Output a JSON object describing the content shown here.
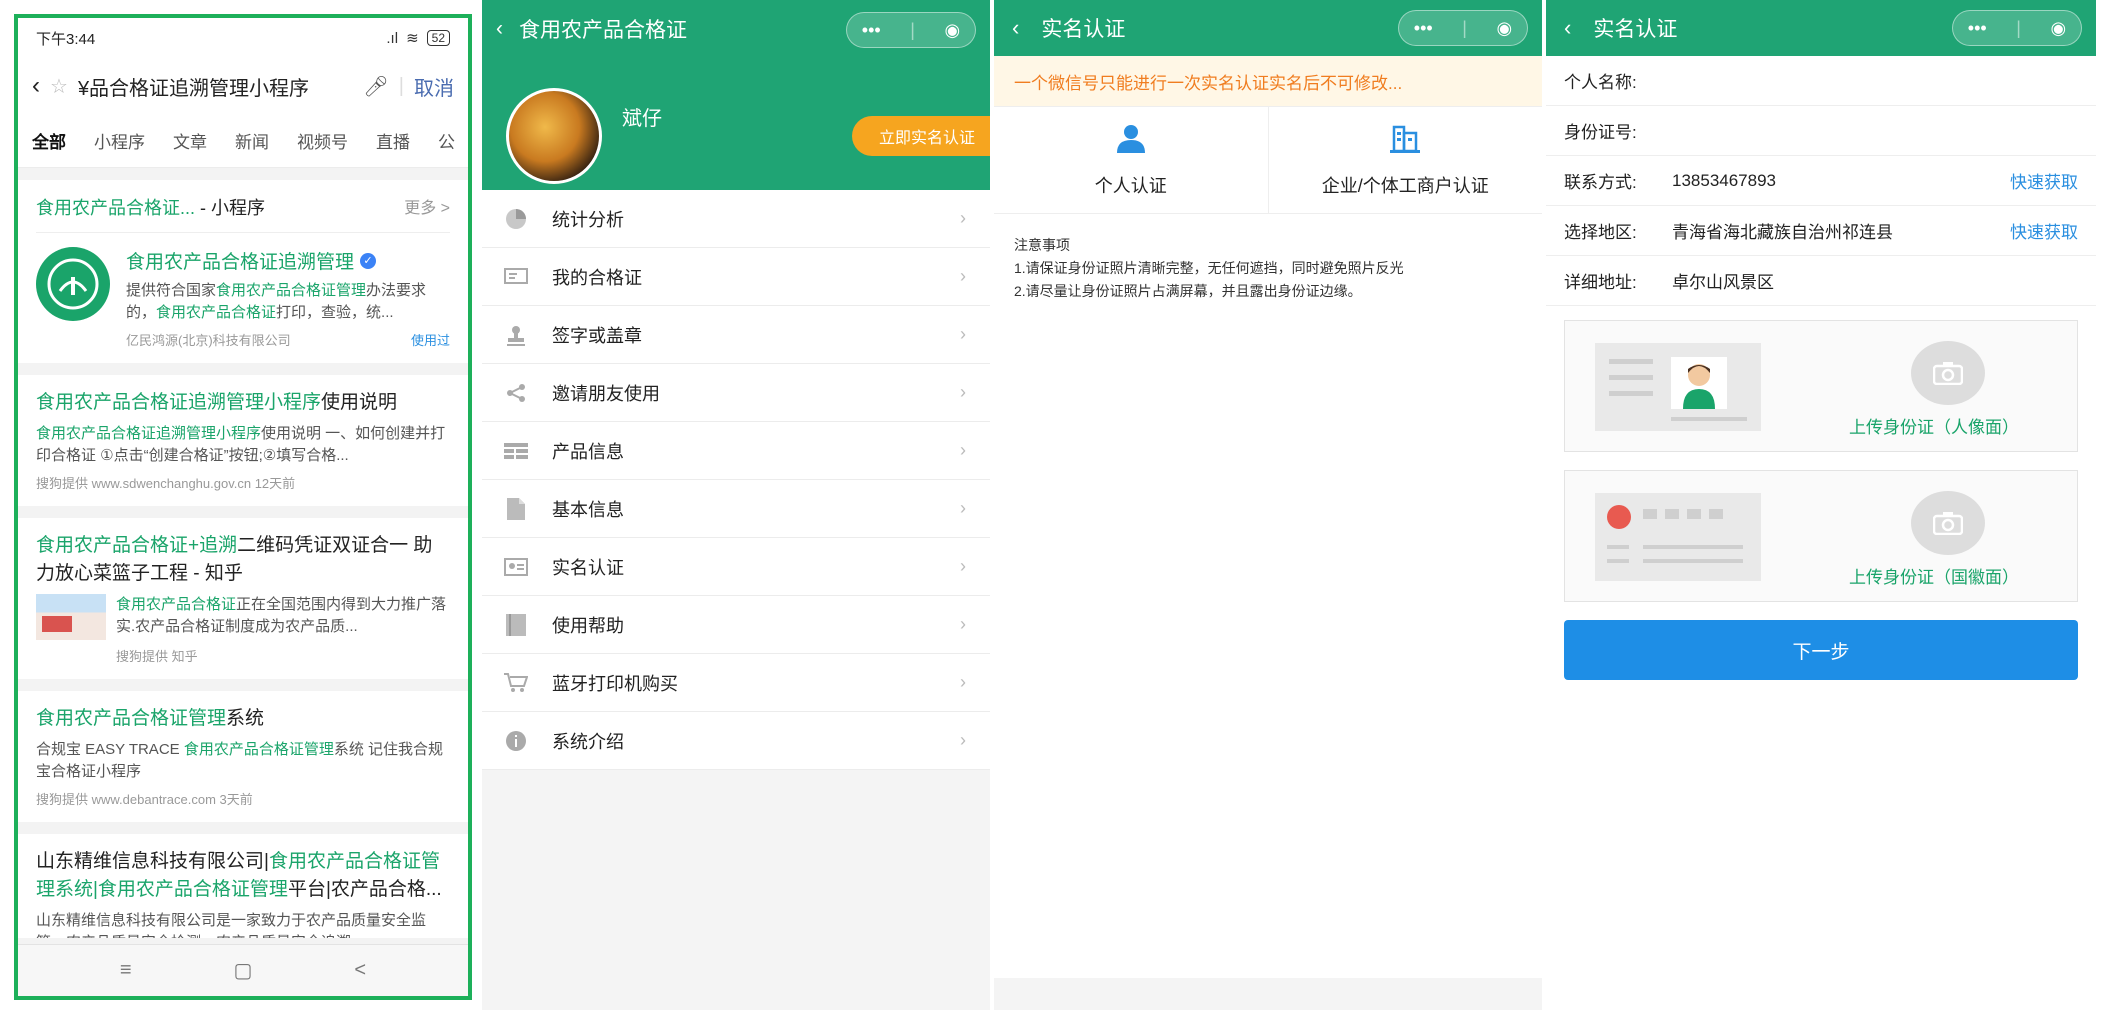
{
  "search_panel": {
    "status": {
      "time": "下午3:44",
      "battery": "52"
    },
    "query": "¥品合格证追溯管理小程序",
    "cancel": "取消",
    "tabs": [
      "全部",
      "小程序",
      "文章",
      "新闻",
      "视频号",
      "直播",
      "公"
    ],
    "mini_program_card": {
      "header_title": "食用农产品合格证...",
      "header_suffix": " - 小程序",
      "more": "更多 >",
      "name": "食用农产品合格证追溯管理",
      "desc_1": "提供符合国家",
      "desc_hl_1": "食用农产品合格证管理",
      "desc_2": "办法要求的，",
      "desc_hl_2": "食用农产品合格证",
      "desc_3": "打印，查验，统...",
      "company": "亿民鸿源(北京)科技有限公司",
      "used": "使用过"
    },
    "results": [
      {
        "title_hl": "食用农产品合格证追溯管理小程序",
        "title_rest": "使用说明",
        "desc_hl": "食用农产品合格证追溯管理小程序",
        "desc_rest": "使用说明 一、如何创建并打印合格证 ①点击“创建合格证”按钮;②填写合格...",
        "source": "搜狗提供 www.sdwenchanghu.gov.cn  12天前"
      },
      {
        "title_hl": "食用农产品合格证+追溯",
        "title_rest": "二维码凭证双证合一 助力放心菜篮子工程 - 知乎",
        "desc_hl": "食用农产品合格证",
        "desc_rest": "正在全国范围内得到大力推广落实.农产品合格证制度成为农产品质...",
        "source": "搜狗提供 知乎"
      },
      {
        "title_hl": "食用农产品合格证管理",
        "title_rest": "系统",
        "desc_pre": "合规宝 EASY TRACE ",
        "desc_hl": "食用农产品合格证管理",
        "desc_rest": "系统 记住我合规宝合格证小程序",
        "source": "搜狗提供 www.debantrace.com  3天前"
      },
      {
        "title_pre": "山东精维信息科技有限公司|",
        "title_hl": "食用农产品合格证管理系统|食用农产品合格证管理",
        "title_rest": "平台|农产品合格...",
        "desc_rest": "山东精维信息科技有限公司是一家致力于农产品质量安全监管、农产品质量安全检测、农产品质量安全追溯..."
      }
    ],
    "nav": [
      "≡",
      "▢",
      "<"
    ]
  },
  "profile_panel": {
    "title": "食用农产品合格证",
    "username": "斌仔",
    "verify_button": "立即实名认证",
    "menu": [
      {
        "label": "统计分析",
        "icon": "pie-chart-icon"
      },
      {
        "label": "我的合格证",
        "icon": "certificate-icon"
      },
      {
        "label": "签字或盖章",
        "icon": "stamp-icon"
      },
      {
        "label": "邀请朋友使用",
        "icon": "share-icon"
      },
      {
        "label": "产品信息",
        "icon": "table-icon"
      },
      {
        "label": "基本信息",
        "icon": "document-icon"
      },
      {
        "label": "实名认证",
        "icon": "id-card-icon"
      },
      {
        "label": "使用帮助",
        "icon": "book-icon"
      },
      {
        "label": "蓝牙打印机购买",
        "icon": "cart-icon"
      },
      {
        "label": "系统介绍",
        "icon": "info-icon"
      }
    ]
  },
  "verify_type_panel": {
    "title": "实名认证",
    "notice": "一个微信号只能进行一次实名认证实名后不可修改...",
    "type_personal": "个人认证",
    "type_business": "企业/个体工商户认证",
    "tips_title": "注意事项",
    "tip_1": "1.请保证身份证照片清晰完整，无任何遮挡，同时避免照片反光",
    "tip_2": "2.请尽量让身份证照片占满屏幕，并且露出身份证边缘。"
  },
  "verify_form_panel": {
    "title": "实名认证",
    "name_label": "个人名称:",
    "id_label": "身份证号:",
    "contact_label": "联系方式:",
    "contact_value": "13853467893",
    "contact_action": "快速获取",
    "region_label": "选择地区:",
    "region_value": "青海省海北藏族自治州祁连县",
    "region_action": "快速获取",
    "address_label": "详细地址:",
    "address_value": "卓尔山风景区",
    "upload_front": "上传身份证（人像面）",
    "upload_back": "上传身份证（国徽面）",
    "next": "下一步"
  },
  "colors": {
    "brand_green": "#1fa474",
    "highlight_green": "#1aa46a",
    "warning_orange": "#f07d20",
    "action_blue": "#1e8ee6",
    "verify_button_orange": "#f6a51f",
    "highlight_box_red": "#e7262f"
  }
}
